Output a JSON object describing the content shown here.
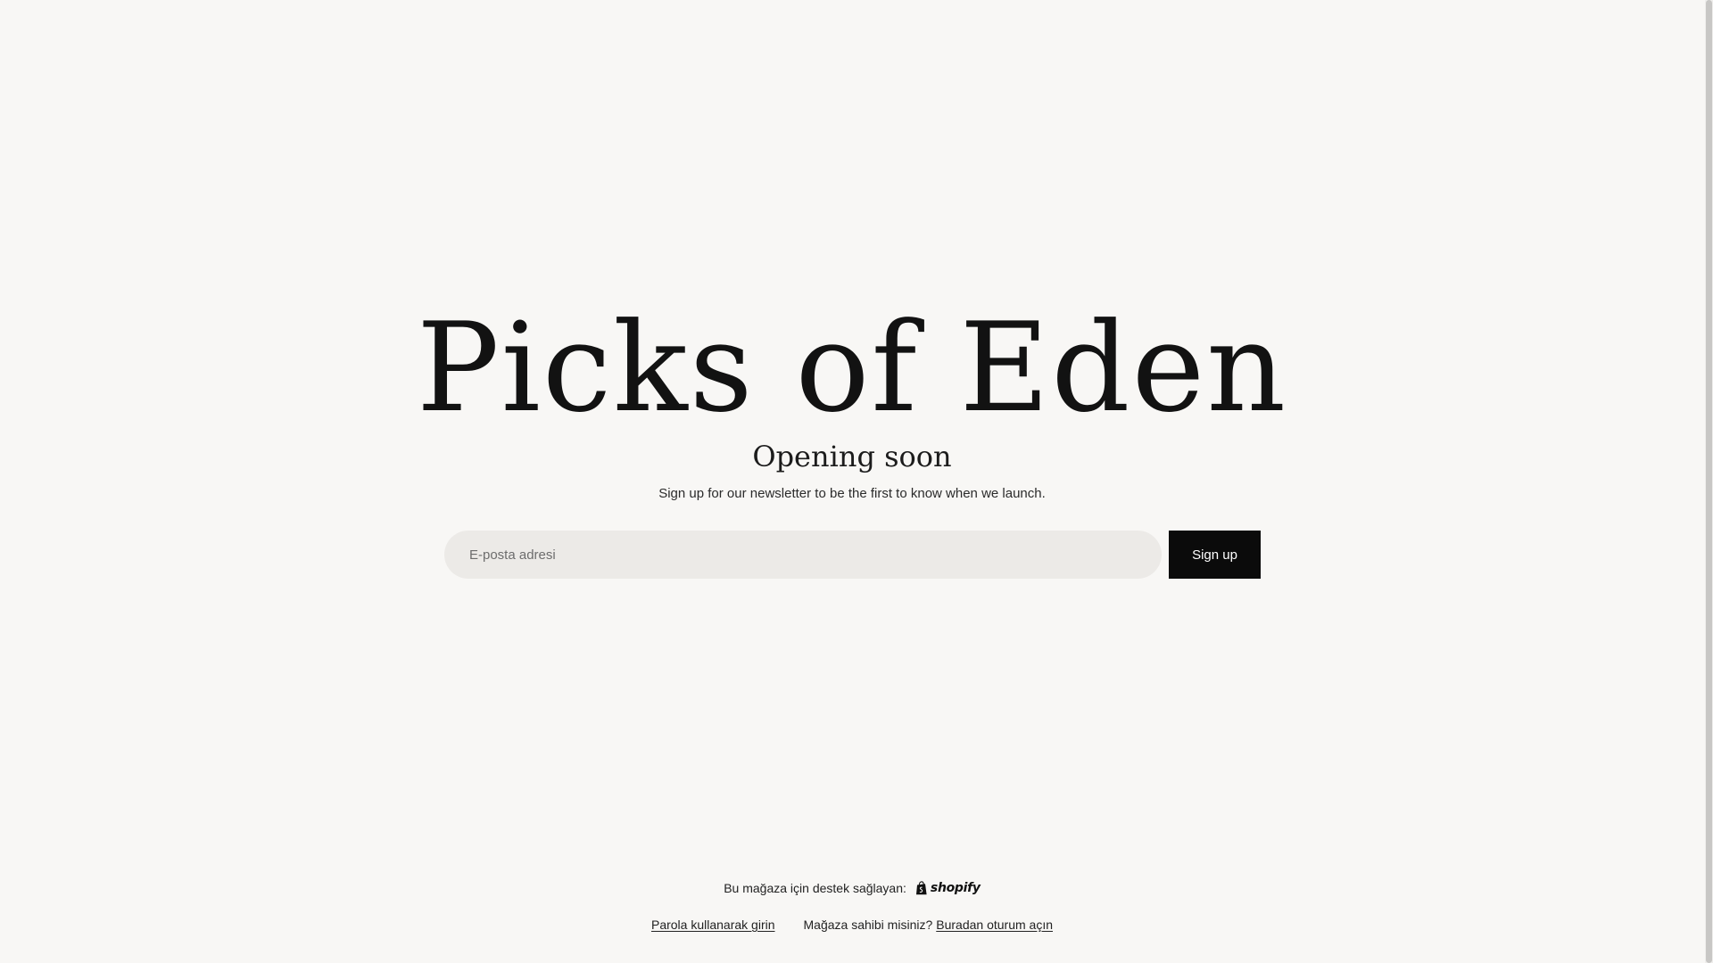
{
  "store": {
    "name": "Picks of Eden",
    "headline": "Opening soon",
    "description": "Sign up for our newsletter to be the first to know when we launch."
  },
  "signup": {
    "email_placeholder": "E-posta adresi",
    "button_label": "Sign up"
  },
  "footer": {
    "powered_by": "Bu mağaza için destek sağlayan:",
    "shopify_logo_text": "shopify",
    "password_link": "Parola kullanarak girin",
    "owner_question": "Mağaza sahibi misiniz?",
    "owner_login_link": "Buradan oturum açın"
  },
  "icons": {
    "shopify": "shopify-bag-icon"
  },
  "colors": {
    "background": "#f8f7f5",
    "input_background": "#eceae7",
    "button_background": "#0b0b0b",
    "button_text": "#ffffff"
  }
}
